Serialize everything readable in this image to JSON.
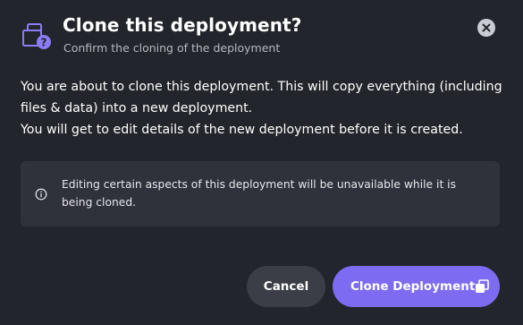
{
  "dialog": {
    "title": "Clone this deployment?",
    "subtitle": "Confirm the cloning of the deployment",
    "header_icon": "clone-question-icon",
    "close_icon": "close-icon"
  },
  "body": {
    "paragraph1": "You are about to clone this deployment. This will copy everything (including files & data) into a new deployment.",
    "paragraph2": "You will get to edit details of the new deployment before it is created."
  },
  "notice": {
    "icon": "info-icon",
    "text": "Editing certain aspects of this deployment will be unavailable while it is being cloned."
  },
  "actions": {
    "cancel_label": "Cancel",
    "clone_label": "Clone Deployment",
    "clone_icon": "copy-icon"
  },
  "colors": {
    "background": "#23252c",
    "accent": "#7d6cf2",
    "notice_bg": "#2f323b",
    "cancel_bg": "#3b3e47",
    "icon_color": "#8b7cf6"
  }
}
